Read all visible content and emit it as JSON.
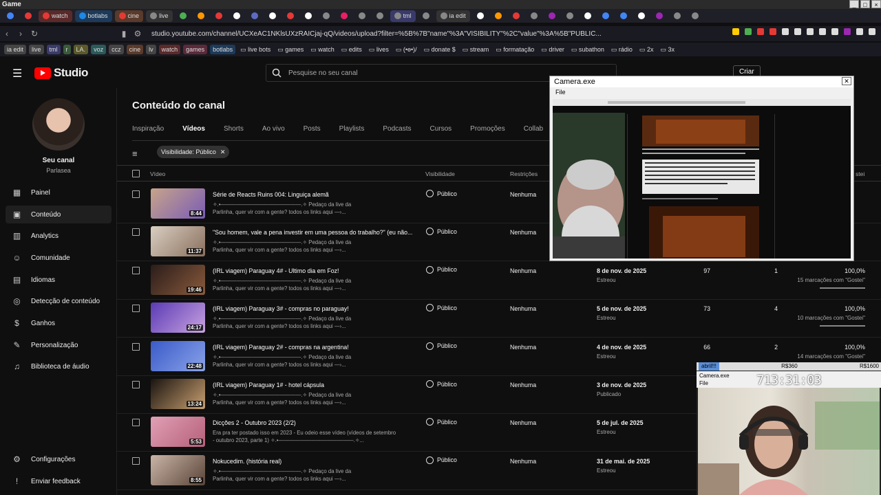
{
  "window": {
    "title": "Game"
  },
  "tabs": [
    {
      "label": "",
      "color": "#4285f4"
    },
    {
      "label": "",
      "color": "#e53935"
    },
    {
      "label": "watch",
      "color": "#e53935",
      "bg": "#5a2a2a"
    },
    {
      "label": "botlabs",
      "color": "#1e88e5",
      "bg": "#1d3a5a"
    },
    {
      "label": "cine",
      "color": "#e53935",
      "bg": "#5a3a2a"
    },
    {
      "label": "live",
      "color": "#888",
      "bg": "#333"
    },
    {
      "label": "",
      "color": "#4caf50"
    },
    {
      "label": "",
      "color": "#ff9800"
    },
    {
      "label": "",
      "color": "#e53935"
    },
    {
      "label": "",
      "color": "#fff"
    },
    {
      "label": "",
      "color": "#5c6bc0"
    },
    {
      "label": "",
      "color": "#fff"
    },
    {
      "label": "",
      "color": "#e53935"
    },
    {
      "label": "",
      "color": "#fff"
    },
    {
      "label": "",
      "color": "#888"
    },
    {
      "label": "",
      "color": "#e91e63"
    },
    {
      "label": "",
      "color": "#888"
    },
    {
      "label": "",
      "color": "#888"
    },
    {
      "label": "tml",
      "color": "#888",
      "bg": "#3a3a6a"
    },
    {
      "label": "",
      "color": "#888"
    },
    {
      "label": "ia edit",
      "color": "#888",
      "bg": "#333"
    },
    {
      "label": "",
      "color": "#fff"
    },
    {
      "label": "",
      "color": "#ff9800"
    },
    {
      "label": "",
      "color": "#e53935"
    },
    {
      "label": "",
      "color": "#888"
    },
    {
      "label": "",
      "color": "#9c27b0"
    },
    {
      "label": "",
      "color": "#888"
    },
    {
      "label": "",
      "color": "#fff"
    },
    {
      "label": "",
      "color": "#4285f4"
    },
    {
      "label": "",
      "color": "#4285f4"
    },
    {
      "label": "",
      "color": "#fff"
    },
    {
      "label": "",
      "color": "#9c27b0"
    },
    {
      "label": "",
      "color": "#888"
    },
    {
      "label": "",
      "color": "#888"
    }
  ],
  "address": {
    "url": "studio.youtube.com/channel/UCXeAC1NKlsUXzRAICjaj-qQ/videos/upload?filter=%5B%7B\"name\"%3A\"VISIBILITY\"%2C\"value\"%3A%5B\"PUBLIC..."
  },
  "bookmarks": [
    {
      "label": "ia edit",
      "bg": "#444"
    },
    {
      "label": "live",
      "bg": "#444"
    },
    {
      "label": "tml",
      "bg": "#3a3a6a"
    },
    {
      "label": "r",
      "bg": "#3a5a3a"
    },
    {
      "label": "LA.",
      "bg": "#5a5a2a"
    },
    {
      "label": "voz",
      "bg": "#2a5a5a"
    },
    {
      "label": "ccz",
      "bg": "#444"
    },
    {
      "label": "cine",
      "bg": "#5a3a2a"
    },
    {
      "label": "lv",
      "bg": "#444"
    },
    {
      "label": "watch",
      "bg": "#5a2a2a"
    },
    {
      "label": "games",
      "bg": "#5a2a3a"
    },
    {
      "label": "botlabs",
      "bg": "#1d3a5a"
    }
  ],
  "bookmark_folders": [
    "live bots",
    "games",
    "watch",
    "edits",
    "lives",
    "(•ө•)/",
    "donate $",
    "stream",
    "formatação",
    "driver",
    "subathon",
    "rádio",
    "2x",
    "3x"
  ],
  "studio": {
    "logo_text": "Studio",
    "search_placeholder": "Pesquise no seu canal",
    "create_label": "Criar"
  },
  "channel": {
    "name": "Seu canal",
    "handle": "Parlasea"
  },
  "nav": [
    {
      "label": "Painel",
      "icon": "dashboard-icon",
      "glyph": "▦"
    },
    {
      "label": "Conteúdo",
      "icon": "content-icon",
      "glyph": "▣",
      "active": true
    },
    {
      "label": "Analytics",
      "icon": "analytics-icon",
      "glyph": "▥"
    },
    {
      "label": "Comunidade",
      "icon": "community-icon",
      "glyph": "☺"
    },
    {
      "label": "Idiomas",
      "icon": "languages-icon",
      "glyph": "▤"
    },
    {
      "label": "Detecção de conteúdo",
      "icon": "content-detection-icon",
      "glyph": "◎"
    },
    {
      "label": "Ganhos",
      "icon": "earn-icon",
      "glyph": "$"
    },
    {
      "label": "Personalização",
      "icon": "customization-icon",
      "glyph": "✎"
    },
    {
      "label": "Biblioteca de áudio",
      "icon": "audio-library-icon",
      "glyph": "♫"
    }
  ],
  "nav_bottom": [
    {
      "label": "Configurações",
      "icon": "settings-icon",
      "glyph": "⚙"
    },
    {
      "label": "Enviar feedback",
      "icon": "feedback-icon",
      "glyph": "!"
    }
  ],
  "page": {
    "title": "Conteúdo do canal",
    "tabs": [
      "Inspiração",
      "Vídeos",
      "Shorts",
      "Ao vivo",
      "Posts",
      "Playlists",
      "Podcasts",
      "Cursos",
      "Promoções",
      "Collab"
    ],
    "active_tab": "Vídeos",
    "filter_chip": "Visibilidade: Público"
  },
  "table": {
    "headers": {
      "video": "Vídeo",
      "visibility": "Visibilidade",
      "restrictions": "Restrições",
      "likes_partial": "stei"
    },
    "rows": [
      {
        "title": "Série de Reacts Ruins 004: Linguiça alemã",
        "desc1": "✧.•———————————————.✧ Pedaço da live da",
        "desc2": "Parlinha, quer vir com a gente? todos os links aqui —›...",
        "duration": "8:44",
        "visibility": "Público",
        "restrictions": "Nenhuma",
        "date": "",
        "status": "",
        "views": "",
        "comments": "",
        "likes": "",
        "likes_sub": "",
        "thumb": [
          "#c7a48a",
          "#7a5cb5"
        ]
      },
      {
        "title": "\"Sou homem, vale a pena investir em uma pessoa do trabalho?\" (eu não...",
        "desc1": "✧.•———————————————.✧ Pedaço da live da",
        "desc2": "Parlinha, quer vir com a gente? todos os links aqui —›...",
        "duration": "11:37",
        "visibility": "Público",
        "restrictions": "Nenhuma",
        "date": "",
        "status": "",
        "views": "",
        "comments": "",
        "likes": "",
        "likes_sub": "",
        "thumb": [
          "#d9cfc2",
          "#8a6f5c"
        ]
      },
      {
        "title": "(IRL viagem) Paraguay 4# - Ultimo dia em Foz!",
        "desc1": "✧.•———————————————.✧ Pedaço da live da",
        "desc2": "Parlinha, quer vir com a gente? todos os links aqui —›...",
        "duration": "19:46",
        "visibility": "Público",
        "restrictions": "Nenhuma",
        "date": "8 de nov. de 2025",
        "status": "Estreou",
        "views": "97",
        "comments": "1",
        "likes": "100,0%",
        "likes_sub": "15 marcações com \"Gostei\"",
        "thumb": [
          "#2a1d1a",
          "#8a5a3c"
        ]
      },
      {
        "title": "(IRL viagem) Paraguay 3# - compras no paraguay!",
        "desc1": "✧.•———————————————.✧ Pedaço da live da",
        "desc2": "Parlinha, quer vir com a gente? todos os links aqui —›...",
        "duration": "24:17",
        "visibility": "Público",
        "restrictions": "Nenhuma",
        "date": "5 de nov. de 2025",
        "status": "Estreou",
        "views": "73",
        "comments": "4",
        "likes": "100,0%",
        "likes_sub": "10 marcações com \"Gostei\"",
        "thumb": [
          "#5a3ab5",
          "#c9a3e0"
        ]
      },
      {
        "title": "(IRL viagem) Paraguay 2# - compras na argentina!",
        "desc1": "✧.•———————————————.✧ Pedaço da live da",
        "desc2": "Parlinha, quer vir com a gente? todos os links aqui —›...",
        "duration": "22:48",
        "visibility": "Público",
        "restrictions": "Nenhuma",
        "date": "4 de nov. de 2025",
        "status": "Estreou",
        "views": "66",
        "comments": "2",
        "likes": "100,0%",
        "likes_sub": "14 marcações com \"Gostei\"",
        "thumb": [
          "#3a5ac9",
          "#8aa3e8"
        ]
      },
      {
        "title": "(IRL viagem) Paraguay 1# - hotel cápsula",
        "desc1": "✧.•———————————————.✧ Pedaço da live da",
        "desc2": "Parlinha, quer vir com a gente? todos os links aqui —›...",
        "duration": "13:24",
        "visibility": "Público",
        "restrictions": "Nenhuma",
        "date": "3 de nov. de 2025",
        "status": "Publicado",
        "views": "",
        "comments": "",
        "likes": "",
        "likes_sub": "",
        "thumb": [
          "#1a1410",
          "#c9a070"
        ]
      },
      {
        "title": "Dicções 2 - Outubro 2023 (2/2)",
        "desc1": "Era pra ter postado isso em 2023 - Eu odeio esse vídeo (vídeos de setembro",
        "desc2": "- outubro 2023, parte 1) ✧.•——————————————.✧...",
        "duration": "5:53",
        "visibility": "Público",
        "restrictions": "Nenhuma",
        "date": "5 de jul. de 2025",
        "status": "Estreou",
        "views": "",
        "comments": "",
        "likes": "",
        "likes_sub": "",
        "thumb": [
          "#e0a0b5",
          "#b5607a"
        ]
      },
      {
        "title": "Nokucedim. (história real)",
        "desc1": "✧.•———————————————.✧ Pedaço da live da",
        "desc2": "Parlinha, quer vir com a gente? todos os links aqui —›...",
        "duration": "8:55",
        "visibility": "Público",
        "restrictions": "Nenhuma",
        "date": "31 de mai. de 2025",
        "status": "Estreou",
        "views": "",
        "comments": "",
        "likes": "",
        "likes_sub": "",
        "thumb": [
          "#c9b5a8",
          "#5a4438"
        ]
      }
    ]
  },
  "camera1": {
    "title": "Camera.exe",
    "menu": "File"
  },
  "camera2": {
    "bar_left": "abril!!!",
    "bar_mid": "R$360",
    "bar_right": "R$1600",
    "title": "Camera.exe",
    "menu": "File",
    "timer": "713:31:03"
  }
}
